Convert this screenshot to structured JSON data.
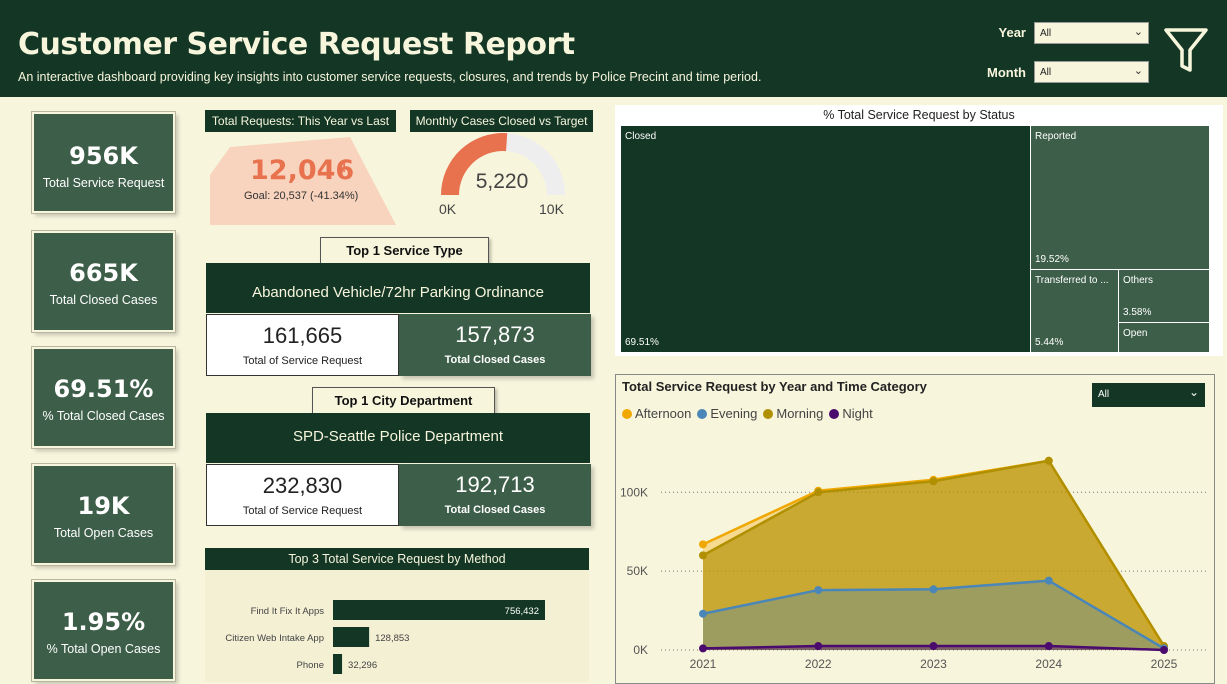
{
  "header": {
    "title": "Customer Service Request Report",
    "subtitle": "An interactive dashboard providing key insights into customer service requests, closures, and trends by Police Precint and time period.",
    "filters": [
      {
        "label": "Year",
        "value": "All"
      },
      {
        "label": "Month",
        "value": "All"
      }
    ],
    "filter_icon": "funnel-icon"
  },
  "kpis": [
    {
      "value": "956K",
      "label": "Total Service Request"
    },
    {
      "value": "665K",
      "label": "Total Closed Cases"
    },
    {
      "value": "69.51%",
      "label": "% Total Closed Cases"
    },
    {
      "value": "19K",
      "label": "Total Open Cases"
    },
    {
      "value": "1.95%",
      "label": "% Total Open Cases"
    }
  ],
  "yoy": {
    "title": "Total Requests: This Year vs Last",
    "value": "12,046",
    "flag": "!",
    "goal": "Goal: 20,537 (-41.34%)"
  },
  "gauge": {
    "title": "Monthly Cases Closed vs Target",
    "value": "5,220",
    "min": "0K",
    "max": "10K",
    "fraction": 0.522
  },
  "top_service": {
    "label": "Top 1 Service Type",
    "name": "Abandoned Vehicle/72hr Parking Ordinance",
    "total": "161,665",
    "total_label": "Total of Service Request",
    "closed": "157,873",
    "closed_label": "Total Closed Cases"
  },
  "top_dept": {
    "label": "Top 1 City Department",
    "name": "SPD-Seattle Police Department",
    "total": "232,830",
    "total_label": "Total of Service Request",
    "closed": "192,713",
    "closed_label": "Total Closed Cases"
  },
  "method_chart": {
    "title": "Top 3 Total Service Request by Method",
    "items": [
      {
        "name": "Find It Fix It Apps",
        "value": 756432,
        "label": "756,432"
      },
      {
        "name": "Citizen Web Intake App",
        "value": 128853,
        "label": "128,853"
      },
      {
        "name": "Phone",
        "value": 32296,
        "label": "32,296"
      }
    ],
    "color": "#133625"
  },
  "status_treemap": {
    "title": "% Total Service Request by Status",
    "cells": [
      {
        "name": "Closed",
        "pct": "69.51%",
        "color": "#133625"
      },
      {
        "name": "Reported",
        "pct": "19.52%",
        "color": "#3d5e48"
      },
      {
        "name": "Transferred to ...",
        "pct": "5.44%",
        "color": "#3d5e48"
      },
      {
        "name": "Others",
        "pct": "3.58%",
        "color": "#3d5e48"
      },
      {
        "name": "Open",
        "pct": "",
        "color": "#3d5e48"
      }
    ]
  },
  "area_chart": {
    "title": "Total Service Request by Year and Time Category",
    "dropdown": "All"
  },
  "chart_data": {
    "type": "area",
    "title": "Total Service Request by Year and Time Category",
    "x": [
      "2021",
      "2022",
      "2023",
      "2024",
      "2025"
    ],
    "yticks": [
      "0K",
      "50K",
      "100K"
    ],
    "ylim": [
      0,
      130000
    ],
    "series": [
      {
        "name": "Afternoon",
        "color": "#f0a800",
        "values": [
          67000,
          101000,
          108000,
          120000,
          2000
        ]
      },
      {
        "name": "Evening",
        "color": "#4a86b8",
        "values": [
          23000,
          38000,
          38500,
          44000,
          1000
        ]
      },
      {
        "name": "Morning",
        "color": "#b08f00",
        "values": [
          60000,
          100000,
          107000,
          120000,
          2500
        ]
      },
      {
        "name": "Night",
        "color": "#4b0a6e",
        "values": [
          1000,
          2500,
          2500,
          2500,
          0
        ]
      }
    ],
    "legend_position": "top-left",
    "grid": true
  }
}
